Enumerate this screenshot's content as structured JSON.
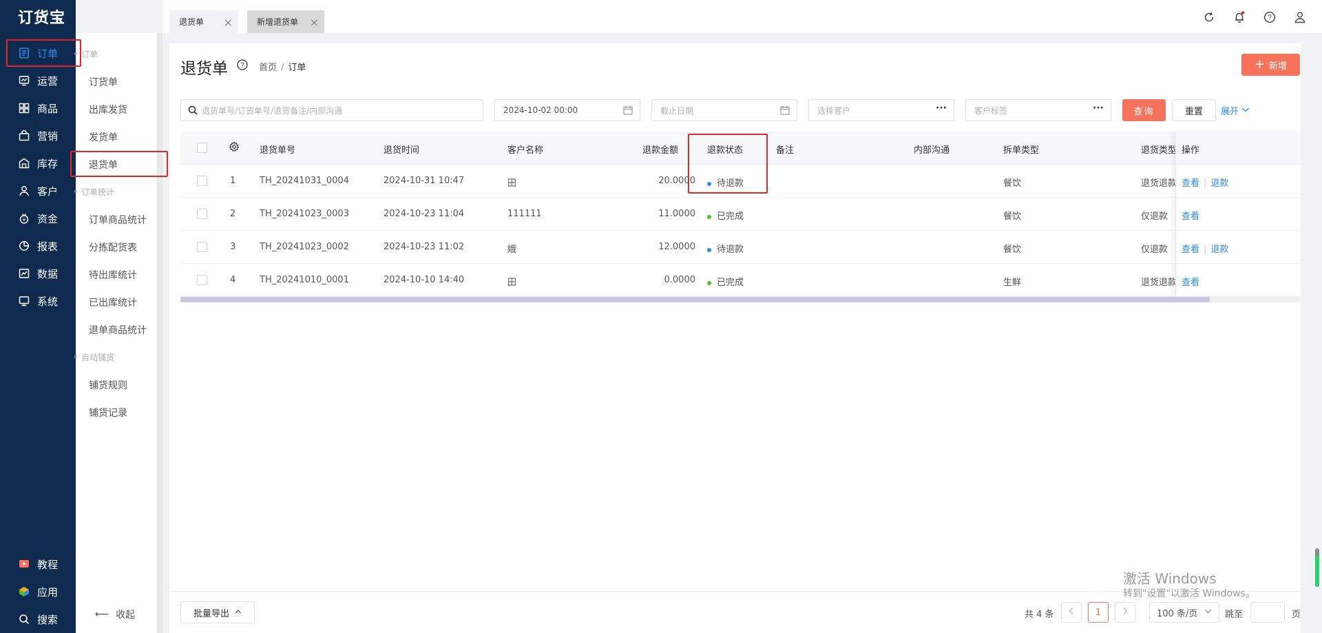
{
  "app": {
    "logo": "订货宝"
  },
  "nav": {
    "items": [
      {
        "label": "订单",
        "icon": "order-icon"
      },
      {
        "label": "运营",
        "icon": "operation-icon"
      },
      {
        "label": "商品",
        "icon": "goods-icon"
      },
      {
        "label": "营销",
        "icon": "marketing-icon"
      },
      {
        "label": "库存",
        "icon": "warehouse-icon"
      },
      {
        "label": "客户",
        "icon": "customer-icon"
      },
      {
        "label": "资金",
        "icon": "money-icon"
      },
      {
        "label": "报表",
        "icon": "report-icon"
      },
      {
        "label": "数据",
        "icon": "data-icon"
      },
      {
        "label": "系统",
        "icon": "system-icon"
      }
    ],
    "bottom": [
      {
        "label": "教程",
        "icon": "tutorial-icon"
      },
      {
        "label": "应用",
        "icon": "apps-icon"
      },
      {
        "label": "搜索",
        "icon": "search-icon"
      }
    ],
    "active_color": "#2d8cf0"
  },
  "subnav": {
    "group1": "订单",
    "items1": [
      "订货单",
      "出库发货",
      "发货单",
      "退货单"
    ],
    "group2": "订单统计",
    "items2": [
      "订单商品统计",
      "分拣配货表",
      "待出库统计",
      "已出库统计",
      "退单商品统计"
    ],
    "group3": "自动铺货",
    "items3": [
      "铺货规则",
      "铺货记录"
    ],
    "collapse": "收起"
  },
  "tabs": [
    {
      "label": "退货单"
    },
    {
      "label": "新增退货单"
    }
  ],
  "header": {
    "title": "退货单",
    "breadcrumb_home": "首页",
    "breadcrumb_sep": "/",
    "breadcrumb_current": "订单",
    "add_label": "新增"
  },
  "filters": {
    "search_placeholder": "退货单号/订货单号/退货备注/内部沟通",
    "start_date": "2024-10-02 00:00",
    "end_date_placeholder": "截止日期",
    "customer_placeholder": "选择客户",
    "tag_placeholder": "客户标签",
    "query_label": "查询",
    "reset_label": "重置",
    "expand_label": "展开"
  },
  "table": {
    "columns": [
      "退货单号",
      "退货时间",
      "客户名称",
      "退款金额",
      "退款状态",
      "备注",
      "内部沟通",
      "拆单类型",
      "退货类型",
      "操作"
    ],
    "rows": [
      {
        "idx": "1",
        "no": "TH_20241031_0004",
        "time": "2024-10-31 10:47",
        "customer": "田",
        "amount": "20.0000",
        "status": "待退款",
        "status_color": "#2d8cf0",
        "note": "",
        "internal": "",
        "split": "餐饮",
        "type": "退货退款",
        "ops": [
          "查看",
          "退款"
        ]
      },
      {
        "idx": "2",
        "no": "TH_20241023_0003",
        "time": "2024-10-23 11:04",
        "customer": "111111",
        "amount": "11.0000",
        "status": "已完成",
        "status_color": "#52c41a",
        "note": "",
        "internal": "",
        "split": "餐饮",
        "type": "仅退款",
        "ops": [
          "查看"
        ]
      },
      {
        "idx": "3",
        "no": "TH_20241023_0002",
        "time": "2024-10-23 11:02",
        "customer": "娥",
        "amount": "12.0000",
        "status": "待退款",
        "status_color": "#2d8cf0",
        "note": "",
        "internal": "",
        "split": "餐饮",
        "type": "仅退款",
        "ops": [
          "查看",
          "退款"
        ]
      },
      {
        "idx": "4",
        "no": "TH_20241010_0001",
        "time": "2024-10-10 14:40",
        "customer": "田",
        "amount": "0.0000",
        "status": "已完成",
        "status_color": "#52c41a",
        "note": "",
        "internal": "",
        "split": "生鲜",
        "type": "退货退款",
        "ops": [
          "查看"
        ]
      }
    ]
  },
  "footer": {
    "export_label": "批量导出",
    "total": "共 4 条",
    "current_page": "1",
    "page_size": "100 条/页",
    "jump_label": "跳至",
    "jump_unit": "页"
  },
  "watermark": {
    "line1": "激活 Windows",
    "line2": "转到\"设置\"以激活 Windows。"
  },
  "colors": {
    "brand": "#f5735a",
    "nav_bg": "#0f2a4f",
    "link": "#2d8cf0",
    "highlight_box": "#e0272a"
  }
}
